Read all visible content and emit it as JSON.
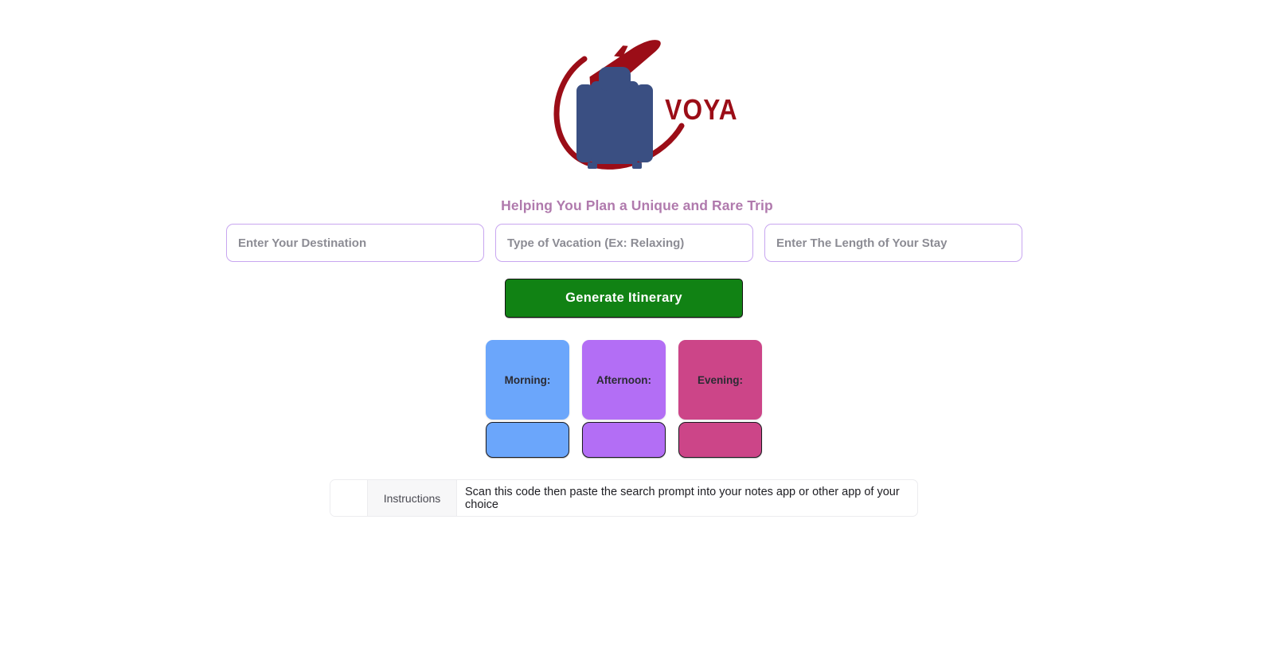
{
  "brand": {
    "name": "VOYAGERAI",
    "logo_icon": "airplane-suitcase-logo",
    "colors": {
      "brand_red": "#9b0d17",
      "suitcase_navy": "#3a4f82",
      "tagline_purple": "#b07aad",
      "button_green": "#118214",
      "input_border": "#c8a6f0"
    }
  },
  "tagline": "Helping You Plan a Unique and Rare Trip",
  "form": {
    "destination": {
      "value": "",
      "placeholder": "Enter Your Destination"
    },
    "vacation_type": {
      "value": "",
      "placeholder": "Type of Vacation (Ex: Relaxing)"
    },
    "stay_length": {
      "value": "",
      "placeholder": "Enter The Length of Your Stay"
    },
    "submit_label": "Generate Itinerary"
  },
  "itinerary_cards": [
    {
      "label": "Morning:",
      "color": "#6ba6fb",
      "content": ""
    },
    {
      "label": "Afternoon:",
      "color": "#b36ef5",
      "content": ""
    },
    {
      "label": "Evening:",
      "color": "#cc4588",
      "content": ""
    }
  ],
  "instructions": {
    "blank_cell": "",
    "header": "Instructions",
    "text": "Scan this code then paste the search prompt into your notes app or other app of your choice"
  }
}
